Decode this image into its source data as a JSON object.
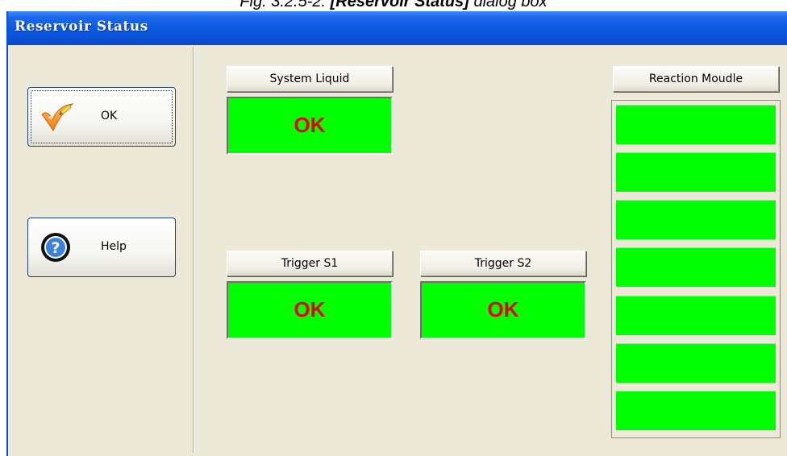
{
  "caption": {
    "prefix": "Fig. 3.2.5-2. ",
    "bold": "[Reservoir Status]",
    "suffix": " dialog box"
  },
  "window": {
    "title": "Reservoir Status",
    "accent_color": "#0a58e0"
  },
  "buttons": {
    "ok": {
      "label": "OK",
      "icon": "checkmark-pencil-icon"
    },
    "help": {
      "label": "Help",
      "icon": "question-mark-icon"
    }
  },
  "reservoirs": {
    "system_liquid": {
      "label": "System Liquid",
      "status": "OK"
    },
    "trigger_s1": {
      "label": "Trigger S1",
      "status": "OK"
    },
    "trigger_s2": {
      "label": "Trigger S2",
      "status": "OK"
    }
  },
  "reaction_module": {
    "label": "Reaction Moudle",
    "slot_count": 7,
    "status_color": "#00ff00"
  },
  "colors": {
    "status_ok_bg": "#00ff00",
    "status_ok_text": "#e80000",
    "dialog_bg": "#ece9d8"
  }
}
